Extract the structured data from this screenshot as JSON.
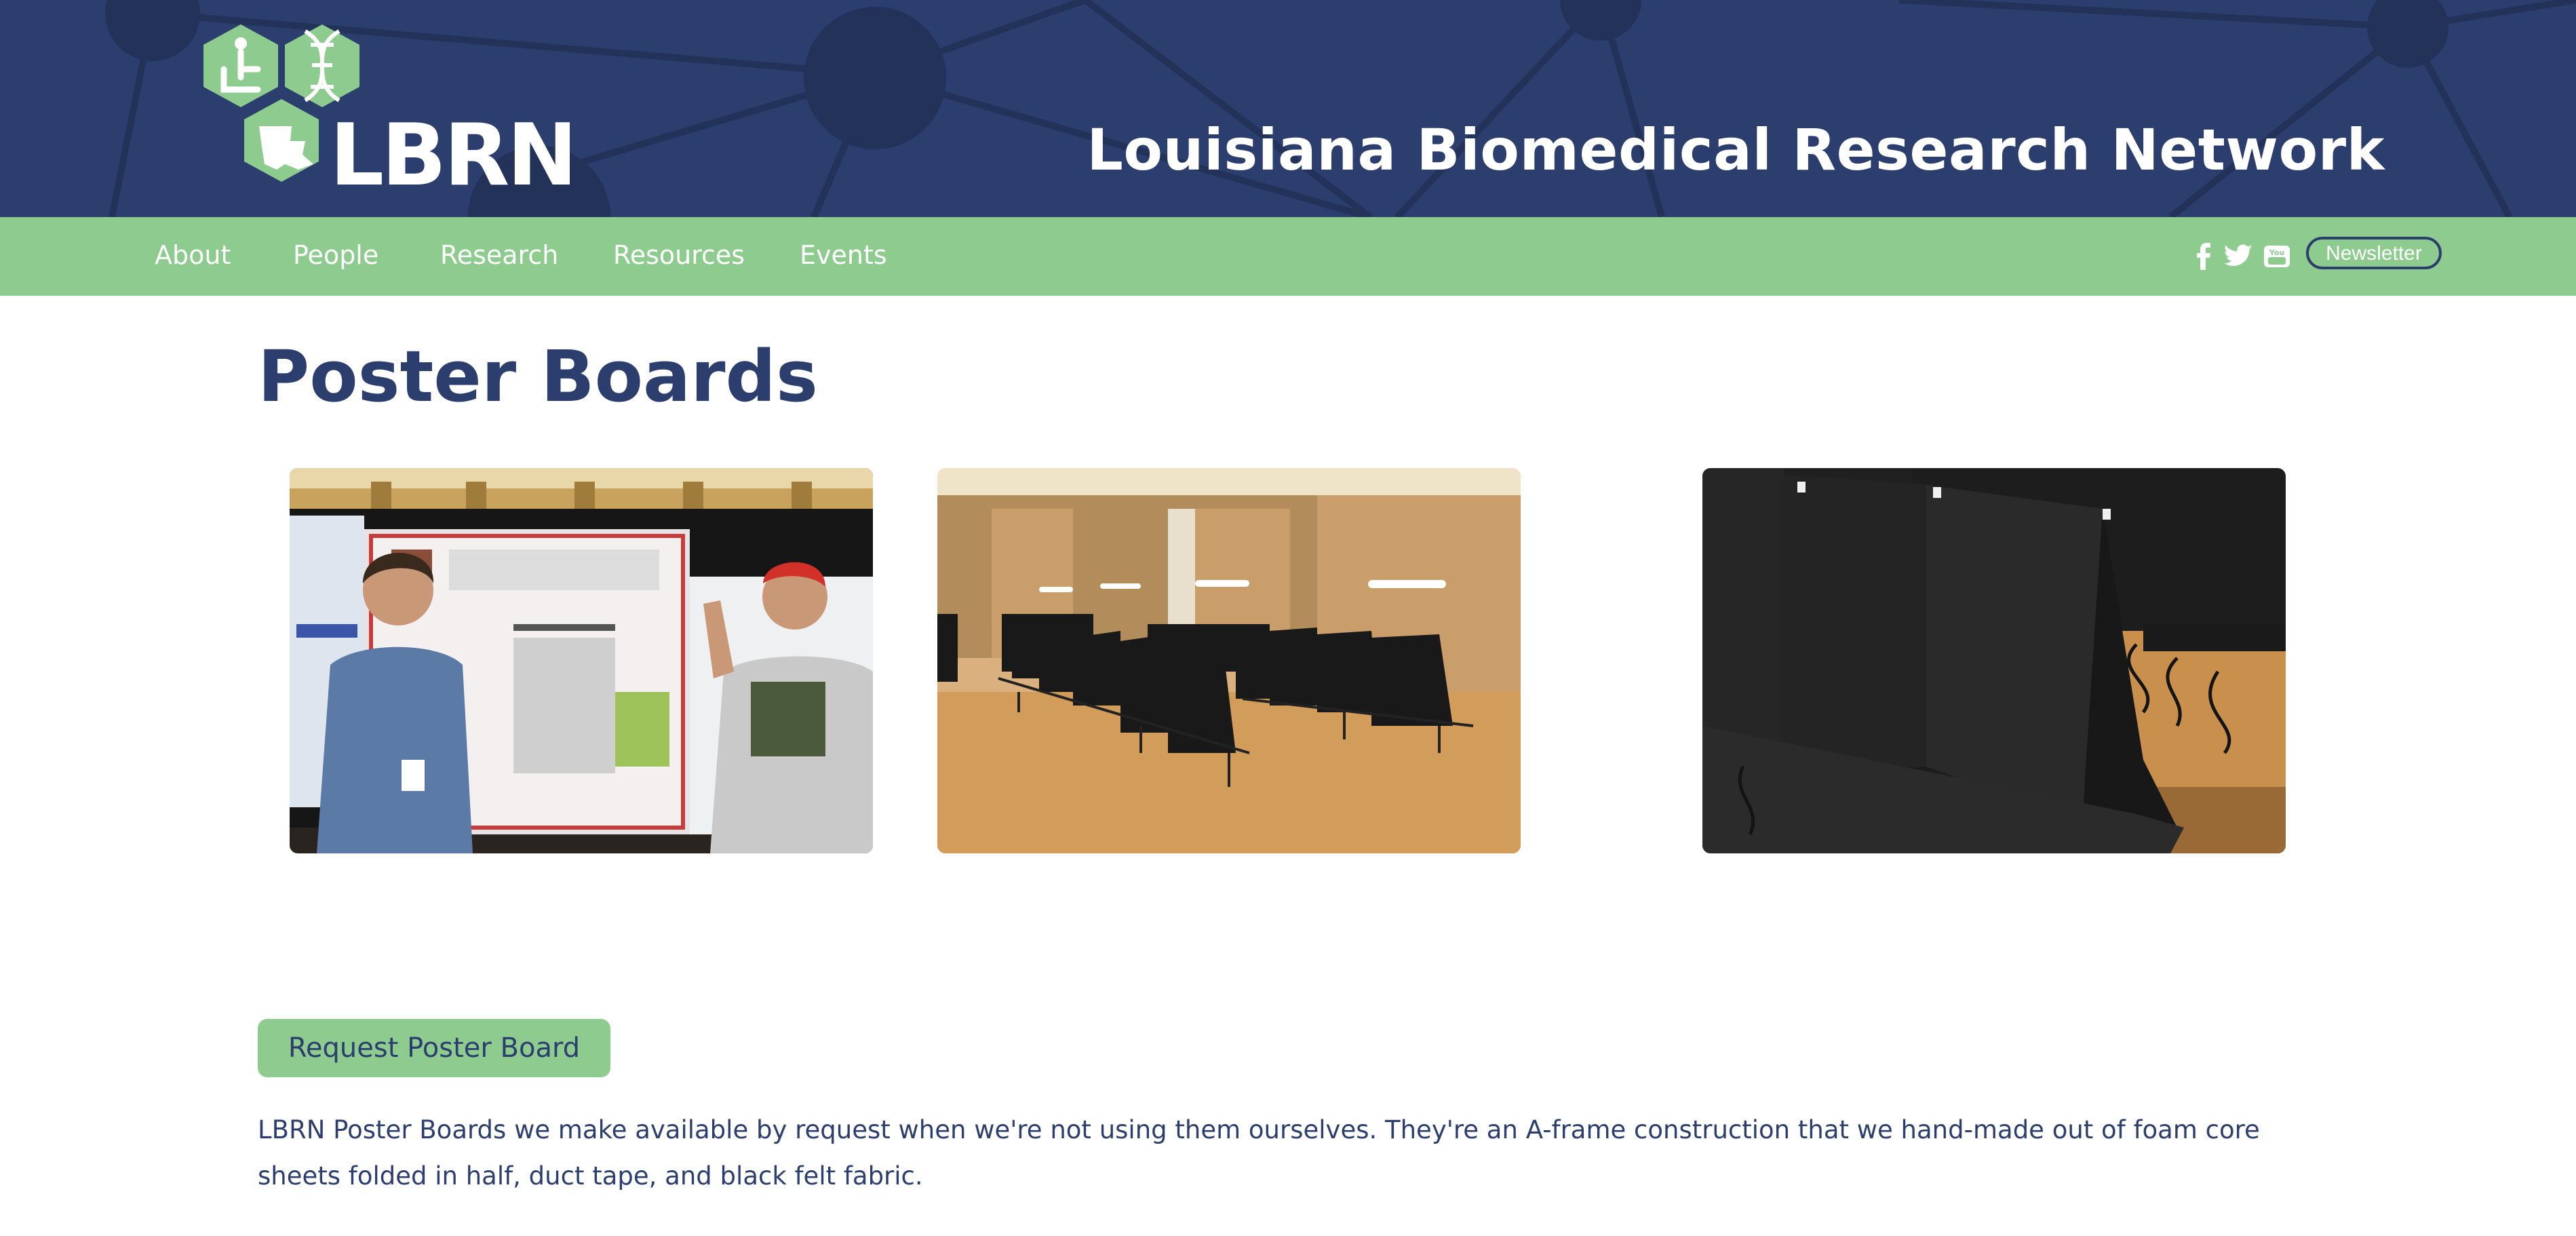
{
  "brand": {
    "logo_text": "LBRN",
    "site_title": "Louisiana Biomedical Research Network"
  },
  "nav": {
    "items": [
      {
        "label": "About"
      },
      {
        "label": "People"
      },
      {
        "label": "Research"
      },
      {
        "label": "Resources"
      },
      {
        "label": "Events"
      }
    ],
    "social_icons": [
      "facebook-icon",
      "twitter-icon",
      "youtube-icon"
    ],
    "newsletter_label": "Newsletter"
  },
  "page": {
    "title": "Poster Boards",
    "gallery": [
      {
        "subject": "students-presenting-poster"
      },
      {
        "subject": "poster-board-rows-in-hall"
      },
      {
        "subject": "poster-board-closeup"
      }
    ],
    "request_button_label": "Request Poster Board",
    "description": "LBRN Poster Boards we make available by request when we're not using them ourselves. They're an A-frame construction that we hand-made out of foam core sheets folded in half, duct tape, and black felt fabric."
  },
  "colors": {
    "header_bg": "#2c3e6e",
    "nav_bg": "#8ecb8e",
    "accent_green": "#8ecb8e",
    "text_dark_blue": "#2c3e6e"
  }
}
